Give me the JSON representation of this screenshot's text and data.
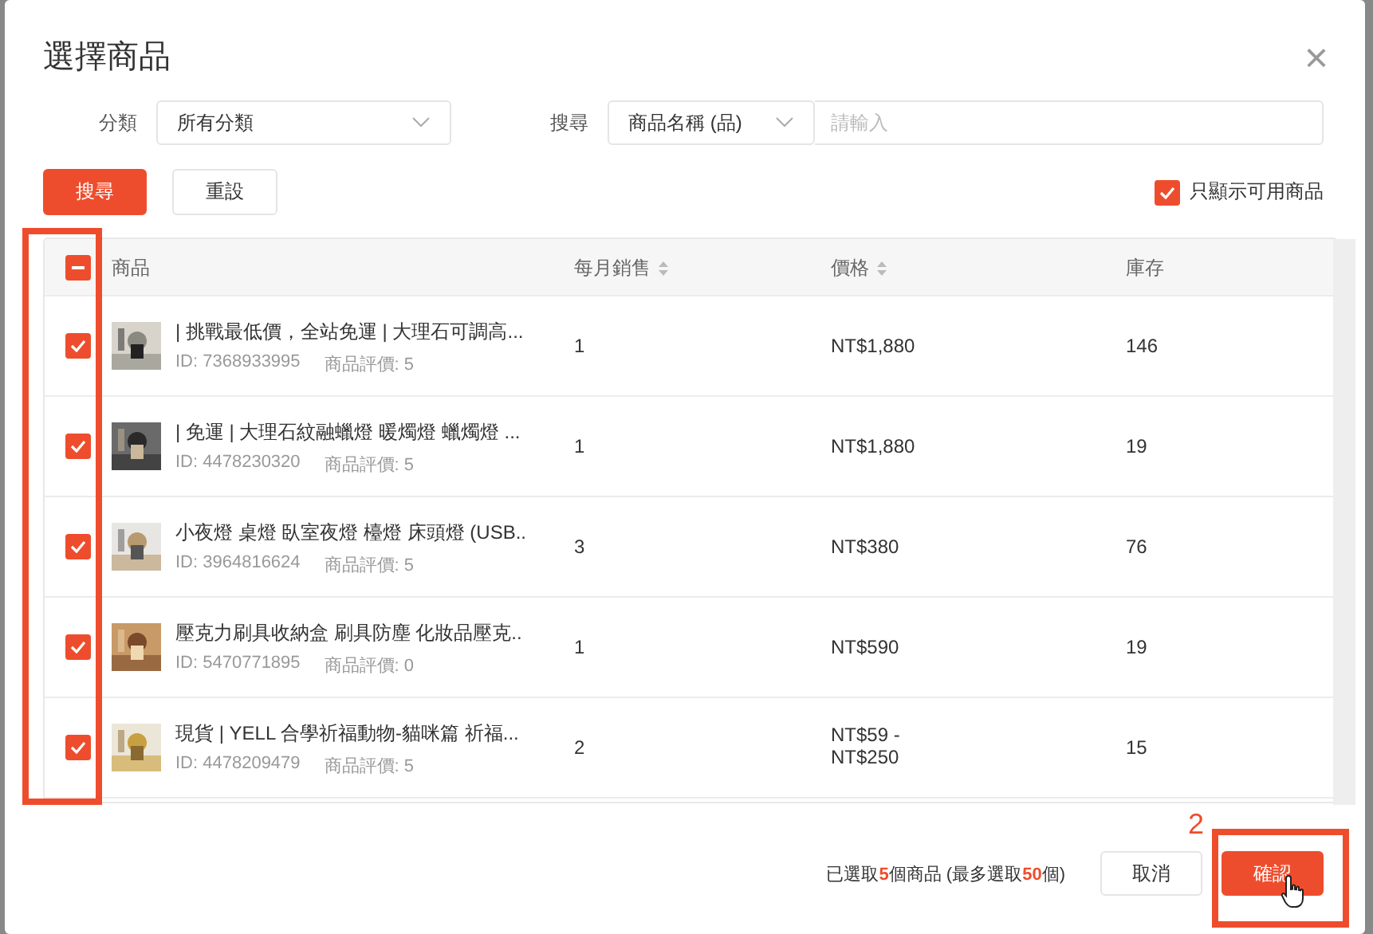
{
  "dialog": {
    "title": "選擇商品",
    "close": "×"
  },
  "filters": {
    "category": {
      "label": "分類",
      "value": "所有分類"
    },
    "search": {
      "label": "搜尋",
      "scope": "商品名稱 (品)",
      "placeholder": "請輸入"
    }
  },
  "actions": [
    {
      "label": "搜尋",
      "kind": "primary"
    },
    {
      "label": "重設",
      "kind": "secondary"
    }
  ],
  "available_only": {
    "label": "只顯示可用商品",
    "checked": true
  },
  "table": {
    "select_all": {
      "checked": true,
      "indeterminate": true
    },
    "columns": [
      {
        "label": "商品",
        "sortable": false
      },
      {
        "label": "每月銷售",
        "sortable": true
      },
      {
        "label": "價格",
        "sortable": true
      },
      {
        "label": "庫存",
        "sortable": false
      }
    ],
    "rows": [
      {
        "checked": true,
        "name": "| 挑戰最低價，全站免運 | 大理石可調高...",
        "id": "ID: 7368933995",
        "rating": "商品評價: 5",
        "monthly_sales": "1",
        "price": "NT$1,880",
        "stock": "146"
      },
      {
        "checked": true,
        "name": "| 免運 | 大理石紋融蠟燈 暖燭燈 蠟燭燈 ...",
        "id": "ID: 4478230320",
        "rating": "商品評價: 5",
        "monthly_sales": "1",
        "price": "NT$1,880",
        "stock": "19"
      },
      {
        "checked": true,
        "name": "小夜燈 桌燈 臥室夜燈 檯燈 床頭燈 (USB..",
        "id": "ID: 3964816624",
        "rating": "商品評價: 5",
        "monthly_sales": "3",
        "price": "NT$380",
        "stock": "76"
      },
      {
        "checked": true,
        "name": "壓克力刷具收納盒 刷具防塵 化妝品壓克..",
        "id": "ID: 5470771895",
        "rating": "商品評價: 0",
        "monthly_sales": "1",
        "price": "NT$590",
        "stock": "19"
      },
      {
        "checked": true,
        "name": "現貨 | YELL 合學祈福動物-貓咪篇 祈福...",
        "id": "ID: 4478209479",
        "rating": "商品評價: 5",
        "monthly_sales": "2",
        "price": "NT$59 - NT$250",
        "stock": "15"
      }
    ]
  },
  "footer": {
    "summary": {
      "before": "已選取",
      "count": "5",
      "middle": "個商品 (最多選取",
      "max": "50",
      "after": "個)"
    },
    "buttons": [
      {
        "label": "取消",
        "kind": "secondary"
      },
      {
        "label": "確認",
        "kind": "primary"
      }
    ]
  },
  "annotation": {
    "step": "2"
  }
}
